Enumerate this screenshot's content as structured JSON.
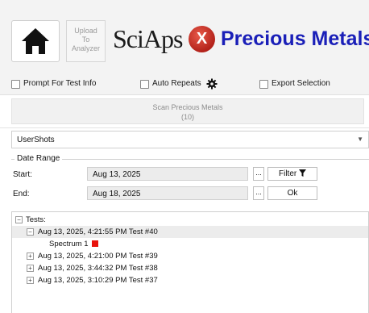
{
  "header": {
    "upload_label": "Upload\nTo\nAnalyzer",
    "logo_text": "SciAps",
    "logo_mark": "X",
    "product_title": "Precious Metals"
  },
  "options": {
    "prompt_label": "Prompt For Test Info",
    "auto_repeats_label": "Auto Repeats",
    "export_label": "Export Selection"
  },
  "scan": {
    "label": "Scan Precious Metals",
    "count": "(10)"
  },
  "user_dropdown": {
    "value": "UserShots"
  },
  "date_range": {
    "legend": "Date Range",
    "start_label": "Start:",
    "start_value": "Aug 13, 2025",
    "end_label": "End:",
    "end_value": "Aug 18, 2025",
    "dots": "...",
    "filter_label": "Filter",
    "ok_label": "Ok"
  },
  "tree": {
    "root": "Tests:",
    "items": [
      {
        "label": "Aug 13, 2025, 4:21:55 PM Test #40",
        "expander": "−"
      },
      {
        "label": "Spectrum 1"
      },
      {
        "label": "Aug 13, 2025, 4:21:00 PM Test #39",
        "expander": "+"
      },
      {
        "label": "Aug 13, 2025, 3:44:32 PM Test #38",
        "expander": "+"
      },
      {
        "label": "Aug 13, 2025, 3:10:29 PM Test #37",
        "expander": "+"
      }
    ],
    "root_expander": "−"
  },
  "colors": {
    "title_blue": "#1a1fb8",
    "logo_red": "#c7291f",
    "spectrum_marker": "#e8130c"
  }
}
